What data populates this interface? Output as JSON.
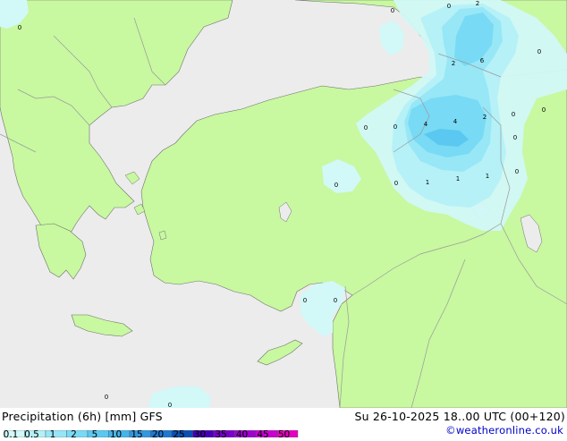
{
  "product": {
    "title": "Precipitation (6h) [mm] GFS",
    "validity": "Su 26-10-2025 18..00 UTC (00+120)",
    "credit": "©weatheronline.co.uk"
  },
  "legend": {
    "ticks": [
      "0.1",
      "0.5",
      "1",
      "2",
      "5",
      "10",
      "15",
      "20",
      "25",
      "30",
      "35",
      "40",
      "45",
      "50"
    ],
    "colors": [
      "#d2f8f8",
      "#b4f0f8",
      "#96e6f6",
      "#78daf4",
      "#5ac8f0",
      "#46b4ea",
      "#3296e0",
      "#1e78d2",
      "#0a50b4",
      "#4600b4",
      "#7800c8",
      "#a000d2",
      "#c800d2",
      "#e600be"
    ]
  },
  "colors": {
    "sea": "#ececec",
    "land": "#c8f8a0",
    "border": "#9a9a9a",
    "coast": "#707070"
  },
  "map": {
    "value_labels": [
      "0",
      "0",
      "2",
      "2",
      "6",
      "0",
      "0",
      "0",
      "4",
      "2",
      "0",
      "0",
      "0",
      "4",
      "0",
      "0",
      "0",
      "1",
      "1",
      "1",
      "0",
      "0",
      "0",
      "0",
      "0"
    ]
  }
}
